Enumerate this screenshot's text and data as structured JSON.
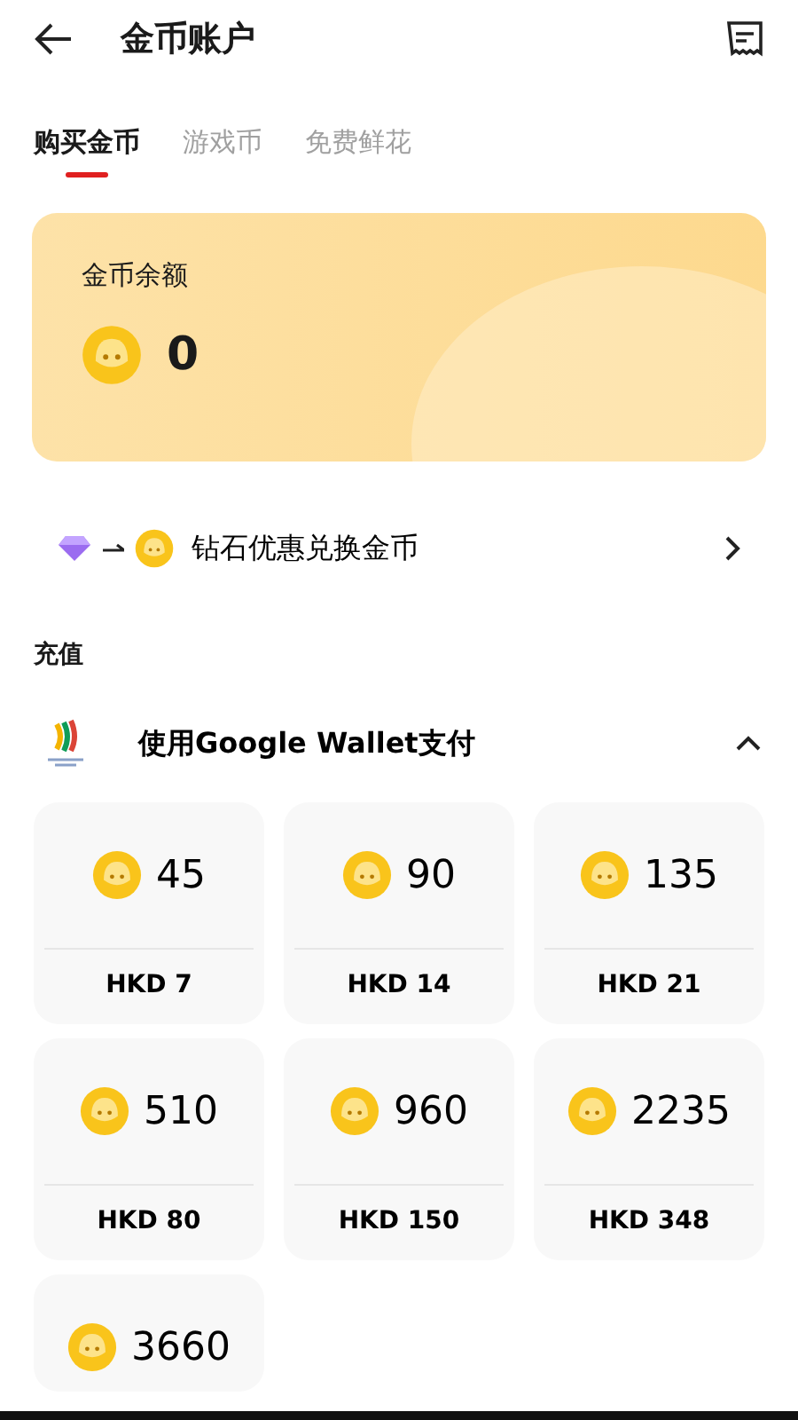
{
  "header": {
    "title": "金币账户"
  },
  "tabs": [
    {
      "label": "购买金币",
      "selected": true
    },
    {
      "label": "游戏币",
      "selected": false
    },
    {
      "label": "免费鲜花",
      "selected": false
    }
  ],
  "balance": {
    "label": "金币余额",
    "amount": "0"
  },
  "exchange": {
    "label": "钻石优惠兑换金币"
  },
  "section_title": "充值",
  "payment": {
    "label": "使用Google Wallet支付",
    "expanded": true
  },
  "packages": [
    {
      "coins": "45",
      "price": "HKD 7"
    },
    {
      "coins": "90",
      "price": "HKD 14"
    },
    {
      "coins": "135",
      "price": "HKD 21"
    },
    {
      "coins": "510",
      "price": "HKD 80"
    },
    {
      "coins": "960",
      "price": "HKD 150"
    },
    {
      "coins": "2235",
      "price": "HKD 348"
    },
    {
      "coins": "3660"
    }
  ]
}
